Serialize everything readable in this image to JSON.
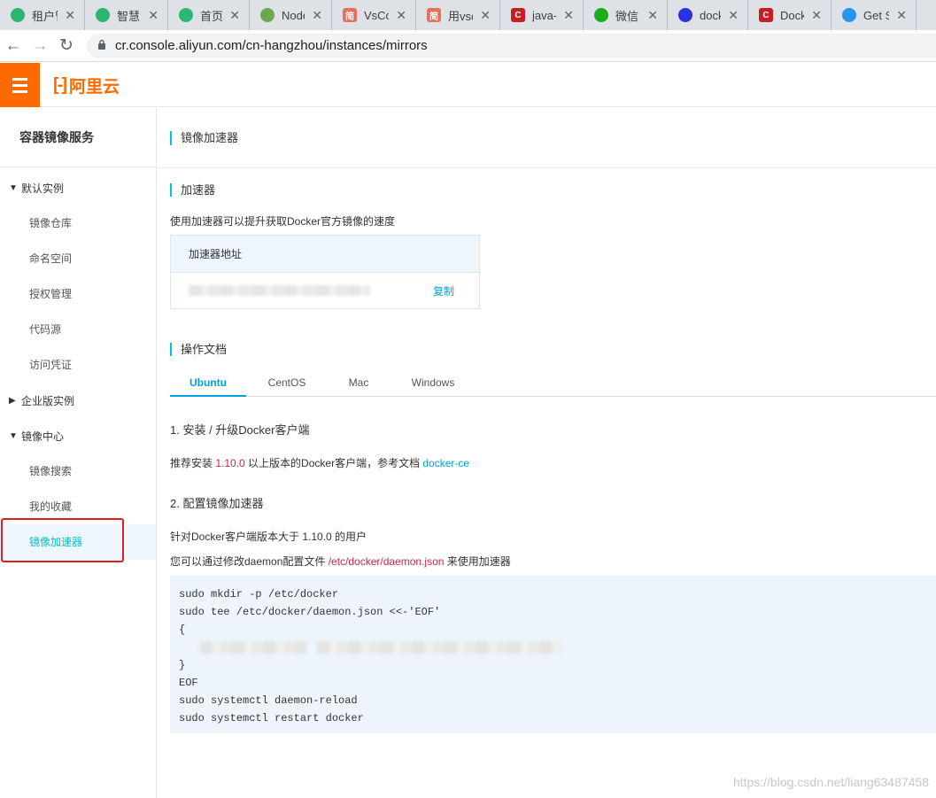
{
  "browser": {
    "tabs": [
      {
        "title": "租户管",
        "icon": "app-icon",
        "color": "#2bb673"
      },
      {
        "title": "智慧园",
        "icon": "app-icon",
        "color": "#2bb673"
      },
      {
        "title": "首页",
        "icon": "app-icon",
        "color": "#2bb673"
      },
      {
        "title": "Node",
        "icon": "nodejs-icon",
        "color": "#6aa84f"
      },
      {
        "title": "VsCo",
        "icon": "jianshu-icon",
        "color": "#ea6f5a",
        "glyph": "简"
      },
      {
        "title": "用vsc",
        "icon": "jianshu-icon",
        "color": "#ea6f5a",
        "glyph": "简"
      },
      {
        "title": "java-",
        "icon": "csdn-icon",
        "color": "#c81d25",
        "glyph": "C"
      },
      {
        "title": "微信",
        "icon": "wechat-icon",
        "color": "#1aad19"
      },
      {
        "title": "dock",
        "icon": "baidu-icon",
        "color": "#2932e1"
      },
      {
        "title": "Dock",
        "icon": "csdn-icon",
        "color": "#c81d25",
        "glyph": "C"
      },
      {
        "title": "Get S",
        "icon": "docker-icon",
        "color": "#2496ed"
      }
    ],
    "url": "cr.console.aliyun.com/cn-hangzhou/instances/mirrors"
  },
  "topbar": {
    "logo_mark": "[-]",
    "logo_text": "阿里云"
  },
  "sidebar": {
    "title": "容器镜像服务",
    "groups": [
      {
        "label": "默认实例",
        "expanded": true,
        "items": [
          "镜像仓库",
          "命名空间",
          "授权管理",
          "代码源",
          "访问凭证"
        ]
      },
      {
        "label": "企业版实例",
        "expanded": false,
        "items": []
      },
      {
        "label": "镜像中心",
        "expanded": true,
        "items": [
          "镜像搜索",
          "我的收藏",
          "镜像加速器"
        ]
      }
    ],
    "active_item": "镜像加速器"
  },
  "main": {
    "page_title": "镜像加速器",
    "accelerator": {
      "section_title": "加速器",
      "description": "使用加速器可以提升获取Docker官方镜像的速度",
      "table_header": "加速器地址",
      "copy_label": "复制"
    },
    "docs": {
      "section_title": "操作文档",
      "tabs": [
        "Ubuntu",
        "CentOS",
        "Mac",
        "Windows"
      ],
      "active_tab": "Ubuntu",
      "step1_title": "1. 安装 / 升级Docker客户端",
      "step1_pre": "推荐安装 ",
      "step1_version": "1.10.0",
      "step1_mid": " 以上版本的Docker客户端，参考文档 ",
      "step1_link": "docker-ce",
      "step2_title": "2. 配置镜像加速器",
      "step2_line1": "针对Docker客户端版本大于 1.10.0 的用户",
      "step2_line2_pre": "您可以通过修改daemon配置文件 ",
      "step2_line2_path": "/etc/docker/daemon.json",
      "step2_line2_post": " 来使用加速器",
      "code_lines": [
        "sudo mkdir -p /etc/docker",
        "sudo tee /etc/docker/daemon.json <<-'EOF'",
        "{",
        "",
        "}",
        "EOF",
        "sudo systemctl daemon-reload",
        "sudo systemctl restart docker"
      ]
    }
  },
  "watermark": "https://blog.csdn.net/liang63487458"
}
